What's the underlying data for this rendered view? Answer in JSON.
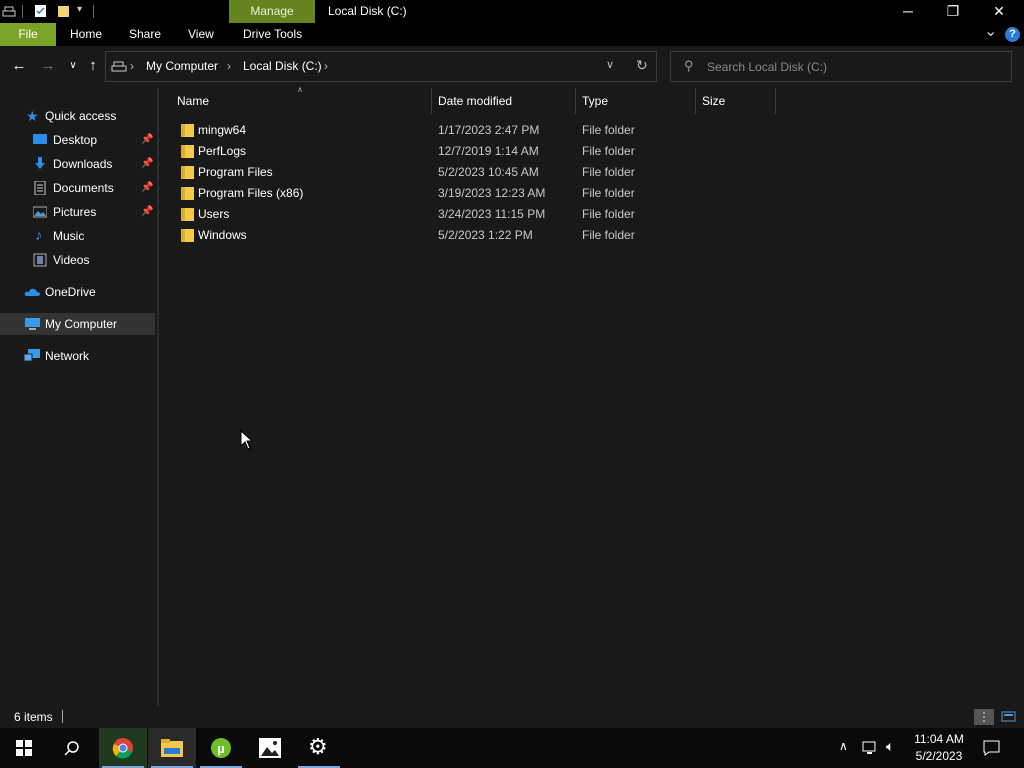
{
  "window": {
    "title": "Local Disk (C:)",
    "contextual_tab": "Manage",
    "minimize": "─",
    "restore": "❐",
    "close": "✕"
  },
  "ribbon": {
    "tabs": [
      "File",
      "Home",
      "Share",
      "View",
      "Drive Tools"
    ],
    "help": "?",
    "collapse": "⌄"
  },
  "address": {
    "breadcrumbs": [
      "My Computer",
      "Local Disk (C:)"
    ],
    "separator": "›",
    "search_placeholder": "Search Local Disk (C:)"
  },
  "nav": {
    "quick_access": "Quick access",
    "pinned": [
      {
        "label": "Desktop",
        "pinned": true
      },
      {
        "label": "Downloads",
        "pinned": true
      },
      {
        "label": "Documents",
        "pinned": true
      },
      {
        "label": "Pictures",
        "pinned": true
      },
      {
        "label": "Music",
        "pinned": false
      },
      {
        "label": "Videos",
        "pinned": false
      }
    ],
    "onedrive": "OneDrive",
    "mycomputer": "My Computer",
    "network": "Network"
  },
  "files": {
    "columns": [
      "Name",
      "Date modified",
      "Type",
      "Size"
    ],
    "rows": [
      {
        "name": "mingw64",
        "date": "1/17/2023 2:47 PM",
        "type": "File folder"
      },
      {
        "name": "PerfLogs",
        "date": "12/7/2019 1:14 AM",
        "type": "File folder"
      },
      {
        "name": "Program Files",
        "date": "5/2/2023 10:45 AM",
        "type": "File folder"
      },
      {
        "name": "Program Files (x86)",
        "date": "3/19/2023 12:23 AM",
        "type": "File folder"
      },
      {
        "name": "Users",
        "date": "3/24/2023 11:15 PM",
        "type": "File folder"
      },
      {
        "name": "Windows",
        "date": "5/2/2023 1:22 PM",
        "type": "File folder"
      }
    ]
  },
  "status": {
    "item_count": "6 items"
  },
  "taskbar": {
    "apps": [
      "start-icon",
      "search-icon",
      "chrome-icon",
      "file-explorer-icon",
      "utorrent-icon",
      "photos-icon",
      "settings-icon"
    ],
    "time": "11:04 AM",
    "date": "5/2/2023"
  },
  "colors": {
    "file_tab": "#7ba327",
    "manage_tab": "#63841f",
    "selected_nav": "#333333",
    "folder": "#f2c94c"
  }
}
